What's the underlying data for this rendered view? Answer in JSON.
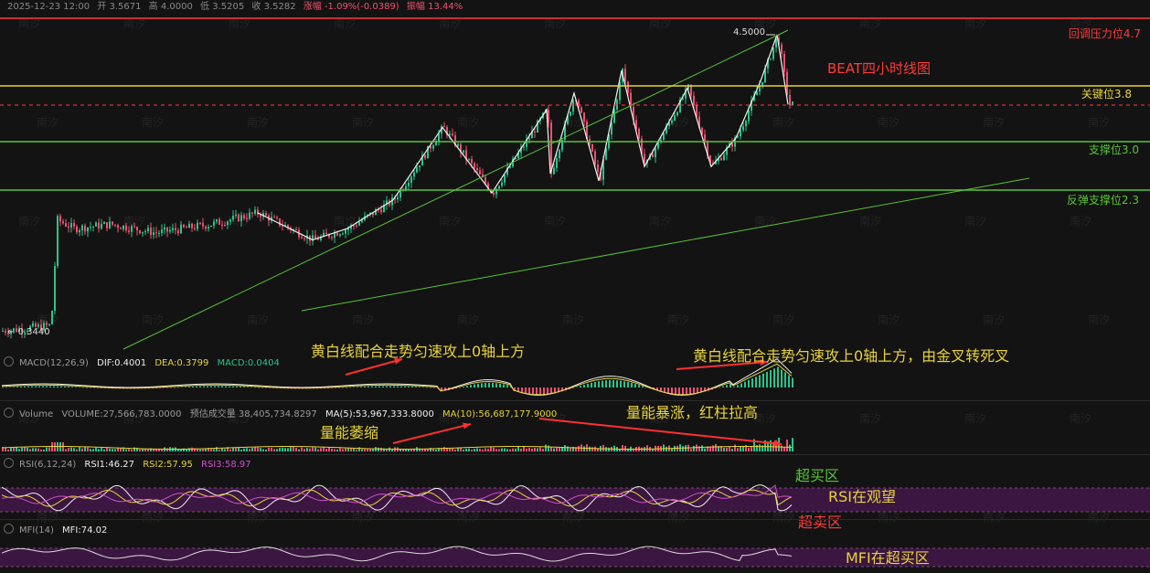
{
  "header": {
    "date": "2025-12-23 12:00",
    "open": "开 3.5671",
    "high": "高 4.0000",
    "low": "低 3.5205",
    "close": "收 3.5282",
    "change": "涨幅 -1.09%(-0.0389)",
    "amplitude": "振幅 13.44%"
  },
  "watermark": "南汐",
  "main_chart": {
    "title": "BEAT四小时线图",
    "high_label": "4.5000",
    "low_label": "0.3440",
    "levels": [
      {
        "label": "回调压力位4.7",
        "color": "#ff3b3b"
      },
      {
        "label": "关键位3.8",
        "color": "#e8d23a"
      },
      {
        "label": "支撑位3.0",
        "color": "#57c435"
      },
      {
        "label": "反弹支撑位2.3",
        "color": "#57c435"
      }
    ]
  },
  "macd": {
    "name": "MACD(12,26,9)",
    "dif": "DIF:0.4001",
    "dea": "DEA:0.3799",
    "macd": "MACD:0.0404",
    "note1": "黄白线配合走势匀速攻上0轴上方",
    "note2": "黄白线配合走势匀速攻上0轴上方，由金叉转死叉"
  },
  "volume": {
    "name": "Volume",
    "volume": "VOLUME:27,566,783.0000",
    "forecast": "预估成交量 38,405,734.8297",
    "ma5": "MA(5):53,967,333.8000",
    "ma10": "MA(10):56,687,177.9000",
    "note1": "量能萎缩",
    "note2": "量能暴涨，红柱拉高"
  },
  "rsi": {
    "name": "RSI(6,12,24)",
    "rsi1": "RSI1:46.27",
    "rsi2": "RSI2:57.95",
    "rsi3": "RSI3:58.97",
    "overbought": "超买区",
    "watch": "RSI在观望",
    "oversold": "超卖区"
  },
  "mfi": {
    "name": "MFI(14)",
    "mfi": "MFI:74.02",
    "note": "MFI在超买区"
  },
  "colors": {
    "up": "#2bc48a",
    "down": "#f0506e",
    "pink": "#a84a8c",
    "yellow": "#e8d23a",
    "green": "#57c435",
    "red": "#ff3b3b"
  },
  "chart_data": {
    "type": "candlestick",
    "y_ticks_shown": [
      "4.5000",
      "0.3440"
    ],
    "price_path": [
      [
        0,
        0.34
      ],
      [
        55,
        0.42
      ],
      [
        62,
        1.9
      ],
      [
        80,
        1.78
      ],
      [
        120,
        1.84
      ],
      [
        170,
        1.72
      ],
      [
        230,
        1.84
      ],
      [
        282,
        2.0
      ],
      [
        342,
        1.62
      ],
      [
        380,
        1.78
      ],
      [
        430,
        2.18
      ],
      [
        484,
        3.2
      ],
      [
        538,
        2.28
      ],
      [
        598,
        3.45
      ],
      [
        602,
        2.55
      ],
      [
        628,
        3.68
      ],
      [
        655,
        2.45
      ],
      [
        680,
        4.0
      ],
      [
        705,
        2.65
      ],
      [
        752,
        3.75
      ],
      [
        778,
        2.65
      ],
      [
        805,
        3.05
      ],
      [
        832,
        3.85
      ],
      [
        850,
        4.5
      ],
      [
        862,
        3.52
      ]
    ]
  }
}
